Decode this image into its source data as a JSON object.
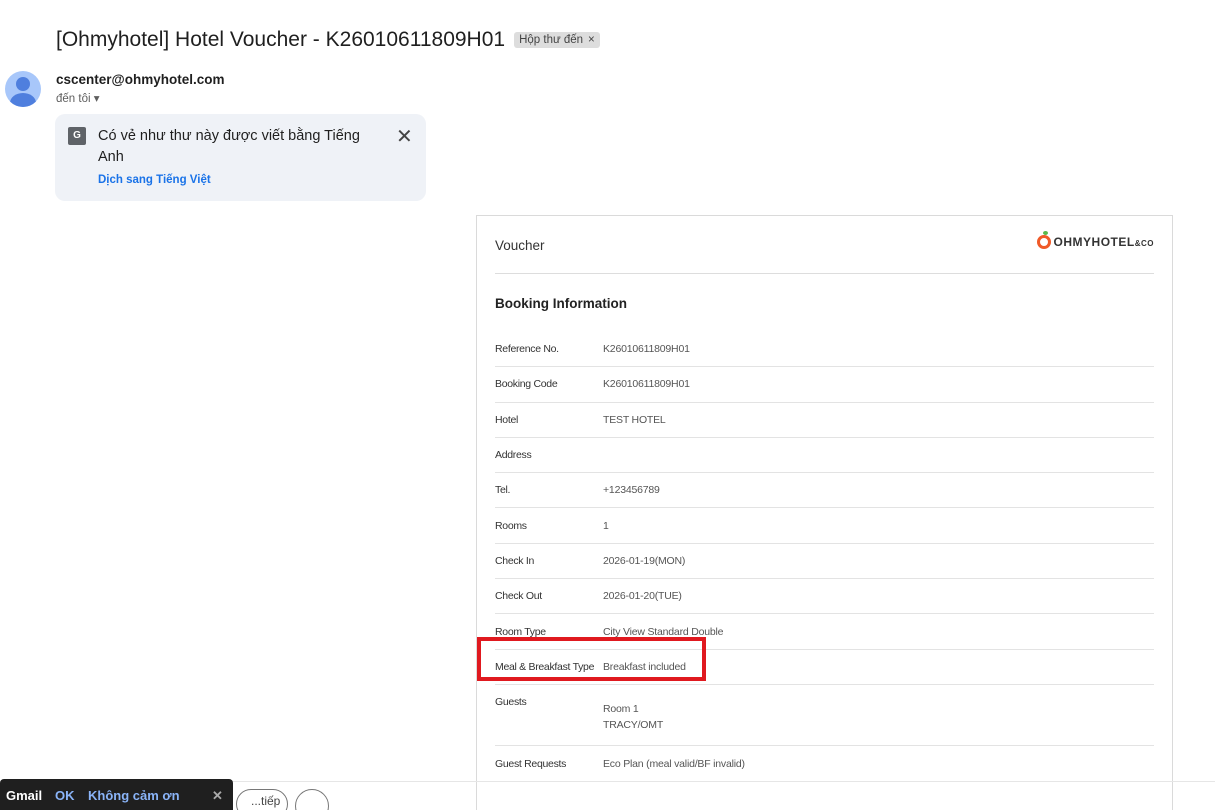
{
  "subject": "[Ohmyhotel] Hotel Voucher - K26010611809H01",
  "label_badge": "Hộp thư đến",
  "label_badge_close": "×",
  "sender": "cscenter@ohmyhotel.com",
  "recipient": "đến tôi",
  "translate": {
    "message": "Có vẻ như thư này được viết bằng Tiếng Anh",
    "link": "Dịch sang Tiếng Việt",
    "close": "✕",
    "icon_text": "G"
  },
  "voucher": {
    "title": "Voucher",
    "logo_text": "OHMYHOTEL",
    "logo_suffix": "&CO",
    "section": "Booking Information",
    "rows": [
      {
        "label": "Reference No.",
        "value": "K26010611809H01"
      },
      {
        "label": "Booking Code",
        "value": "K26010611809H01"
      },
      {
        "label": "Hotel",
        "value": "TEST HOTEL"
      },
      {
        "label": "Address",
        "value": ""
      },
      {
        "label": "Tel.",
        "value": "+123456789"
      },
      {
        "label": "Rooms",
        "value": "1"
      },
      {
        "label": "Check In",
        "value": "2026-01-19(MON)"
      },
      {
        "label": "Check Out",
        "value": "2026-01-20(TUE)"
      },
      {
        "label": "Room Type",
        "value": "City View Standard Double"
      },
      {
        "label": "Meal & Breakfast Type",
        "value": "Breakfast included"
      }
    ],
    "guests": {
      "label": "Guests",
      "room": "Room 1",
      "name": "TRACY/OMT"
    },
    "guest_requests": {
      "label": "Guest Requests",
      "value": "Eco Plan (meal valid/BF invalid)"
    }
  },
  "snackbar": {
    "app": "Gmail",
    "ok": "OK",
    "decline": "Không cảm ơn",
    "close": "✕"
  },
  "bottom_button": "...tiếp"
}
